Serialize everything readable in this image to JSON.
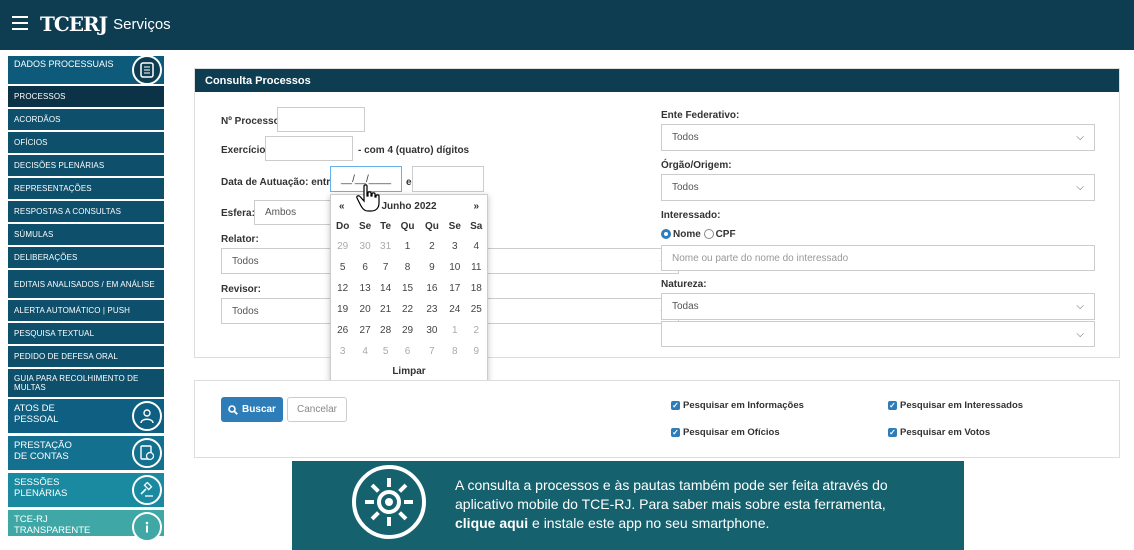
{
  "topbar": {
    "brand_mark": "TCERJ",
    "brand_text": "Serviços"
  },
  "sidebar": {
    "header": "DADOS PROCESSUAIS",
    "items": [
      {
        "label": "PROCESSOS"
      },
      {
        "label": "ACORDÃOS"
      },
      {
        "label": "OFÍCIOS"
      },
      {
        "label": "DECISÕES PLENÁRIAS"
      },
      {
        "label": "REPRESENTAÇÕES"
      },
      {
        "label": "RESPOSTAS A CONSULTAS"
      },
      {
        "label": "SÚMULAS"
      },
      {
        "label": "DELIBERAÇÕES"
      },
      {
        "label": "EDITAIS ANALISADOS / EM ANÁLISE"
      },
      {
        "label": "ALERTA AUTOMÁTICO | PUSH"
      },
      {
        "label": "PESQUISA TEXTUAL"
      },
      {
        "label": "PEDIDO DE DEFESA ORAL"
      },
      {
        "label": "GUIA PARA RECOLHIMENTO DE MULTAS"
      }
    ],
    "sections": [
      {
        "label": "ATOS DE PESSOAL"
      },
      {
        "label": "PRESTAÇÃO DE CONTAS"
      },
      {
        "label": "SESSÕES PLENÁRIAS"
      },
      {
        "label": "TCE-RJ TRANSPARENTE"
      }
    ]
  },
  "consulta": {
    "title": "Consulta Processos",
    "num_processo_label": "Nº Processo:",
    "exercicio_label": "Exercício:",
    "exercicio_hint": "- com 4 (quatro) dígitos",
    "data_label": "Data de Autuação: entre",
    "data_from_value": "__/__/____",
    "data_e": "e",
    "esfera_label": "Esfera:",
    "esfera_value": "Ambos",
    "relator_label": "Relator:",
    "relator_value": "Todos",
    "revisor_label": "Revisor:",
    "revisor_value": "Todos",
    "ente_label": "Ente Federativo:",
    "ente_value": "Todos",
    "orgao_label": "Órgão/Origem:",
    "orgao_value": "Todos",
    "interessado_label": "Interessado:",
    "radio_nome": "Nome",
    "radio_cpf": "CPF",
    "interessado_placeholder": "Nome ou parte do nome do interessado",
    "natureza_label": "Natureza:",
    "natureza_value": "Todas"
  },
  "calendar": {
    "prev": "«",
    "next": "»",
    "month": "Junho 2022",
    "weekdays": [
      "Do",
      "Se",
      "Te",
      "Qu",
      "Qu",
      "Se",
      "Sa"
    ],
    "weeks": [
      [
        "29",
        "30",
        "31",
        "1",
        "2",
        "3",
        "4"
      ],
      [
        "5",
        "6",
        "7",
        "8",
        "9",
        "10",
        "11"
      ],
      [
        "12",
        "13",
        "14",
        "15",
        "16",
        "17",
        "18"
      ],
      [
        "19",
        "20",
        "21",
        "22",
        "23",
        "24",
        "25"
      ],
      [
        "26",
        "27",
        "28",
        "29",
        "30",
        "1",
        "2"
      ],
      [
        "3",
        "4",
        "5",
        "6",
        "7",
        "8",
        "9"
      ]
    ],
    "clear": "Limpar"
  },
  "actions": {
    "buscar": "Buscar",
    "cancelar": "Cancelar",
    "chk_informacoes": "Pesquisar em Informações",
    "chk_interessados": "Pesquisar em Interessados",
    "chk_oficios": "Pesquisar em Ofícios",
    "chk_votos": "Pesquisar em Votos"
  },
  "banner": {
    "text_line1": "A consulta a processos e às pautas também pode ser feita através do",
    "text_line2": "aplicativo mobile do TCE-RJ. Para saber mais sobre esta ferramenta,",
    "link": "clique aqui",
    "text_line3": "e instale este app no seu smartphone."
  },
  "colors": {
    "primary": "#0e3d52",
    "accent": "#2d7db9",
    "banner": "#15616d"
  }
}
